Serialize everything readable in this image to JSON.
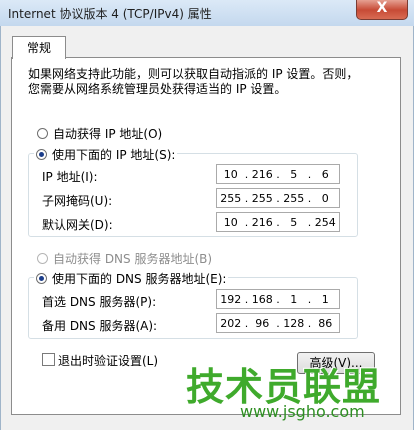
{
  "window": {
    "title": "Internet 协议版本 4 (TCP/IPv4) 属性",
    "close_glyph": "X"
  },
  "tab": {
    "label": "常规"
  },
  "description": {
    "line1": "如果网络支持此功能，则可以获取自动指派的 IP 设置。否则，",
    "line2": "您需要从网络系统管理员处获得适当的 IP 设置。"
  },
  "ip_section": {
    "auto_option": "自动获得 IP 地址(O)",
    "manual_option": "使用下面的 IP 地址(S):",
    "fields": [
      {
        "label": "IP 地址(I):",
        "octets": [
          "10",
          "216",
          "5",
          "6"
        ]
      },
      {
        "label": "子网掩码(U):",
        "octets": [
          "255",
          "255",
          "255",
          "0"
        ]
      },
      {
        "label": "默认网关(D):",
        "octets": [
          "10",
          "216",
          "5",
          "254"
        ]
      }
    ]
  },
  "dns_section": {
    "auto_option": "自动获得 DNS 服务器地址(B)",
    "manual_option": "使用下面的 DNS 服务器地址(E):",
    "fields": [
      {
        "label": "首选 DNS 服务器(P):",
        "octets": [
          "192",
          "168",
          "1",
          "1"
        ]
      },
      {
        "label": "备用 DNS 服务器(A):",
        "octets": [
          "202",
          "96",
          "128",
          "86"
        ]
      }
    ]
  },
  "validate_checkbox": {
    "label": "退出时验证设置(L)",
    "checked": false
  },
  "advanced_button": {
    "label": "高级(V)..."
  },
  "watermark": {
    "text": "技术员联盟",
    "url": "www.jsgho.com"
  }
}
